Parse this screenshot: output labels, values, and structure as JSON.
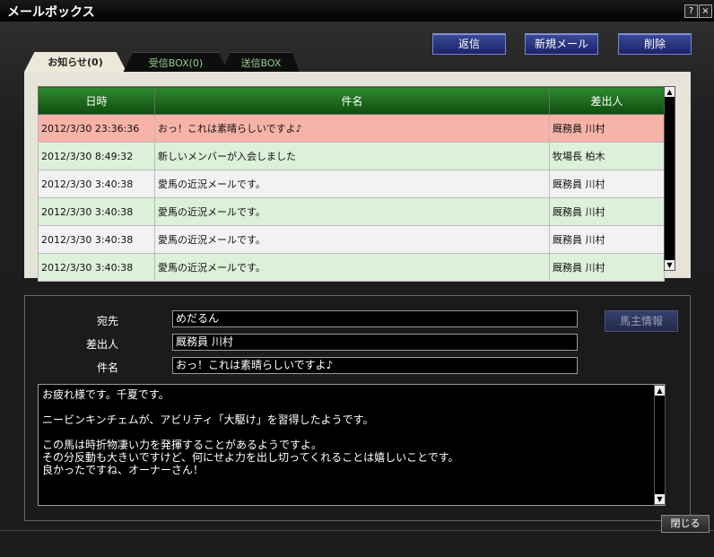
{
  "window": {
    "title": "メールボックス",
    "help": "?",
    "close": "×"
  },
  "toolbar": {
    "reply": "返信",
    "new_mail": "新規メール",
    "delete": "削除"
  },
  "tabs": [
    {
      "label": "お知らせ(0)",
      "active": true
    },
    {
      "label": "受信BOX(0)",
      "active": false
    },
    {
      "label": "送信BOX",
      "active": false
    }
  ],
  "table": {
    "headers": {
      "date": "日時",
      "subject": "件名",
      "sender": "差出人"
    },
    "rows": [
      {
        "date": "2012/3/30 23:36:36",
        "subject": "おっ！これは素晴らしいですよ♪",
        "sender": "厩務員 川村",
        "selected": true
      },
      {
        "date": "2012/3/30 8:49:32",
        "subject": "新しいメンバーが入会しました",
        "sender": "牧場長 柏木"
      },
      {
        "date": "2012/3/30 3:40:38",
        "subject": "愛馬の近況メールです。",
        "sender": "厩務員 川村"
      },
      {
        "date": "2012/3/30 3:40:38",
        "subject": "愛馬の近況メールです。",
        "sender": "厩務員 川村"
      },
      {
        "date": "2012/3/30 3:40:38",
        "subject": "愛馬の近況メールです。",
        "sender": "厩務員 川村"
      },
      {
        "date": "2012/3/30 3:40:38",
        "subject": "愛馬の近況メールです。",
        "sender": "厩務員 川村"
      }
    ]
  },
  "detail": {
    "to_label": "宛先",
    "to_value": "めだるん",
    "from_label": "差出人",
    "from_value": "厩務員 川村",
    "subject_label": "件名",
    "subject_value": "おっ！これは素晴らしいですよ♪",
    "owner_info_button": "馬主情報",
    "body_lines": [
      "お疲れ様です。千夏です。",
      "",
      "ニービンキンチェムが、アビリティ「大駆け」を習得したようです。",
      "",
      "この馬は時折物凄い力を発揮することがあるようですよ。",
      "その分反動も大きいですけど、何にせよ力を出し切ってくれることは嬉しいことです。",
      "良かったですね、オーナーさん！"
    ]
  },
  "footer": {
    "close": "閉じる"
  }
}
